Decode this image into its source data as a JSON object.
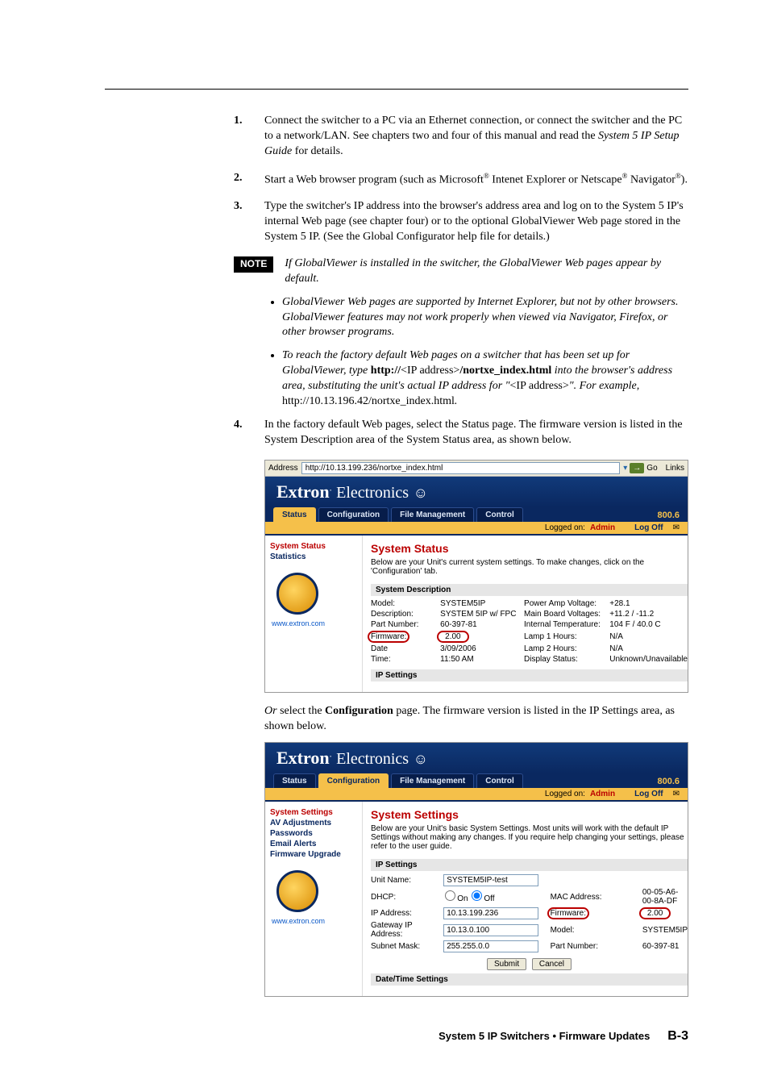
{
  "steps": {
    "s1": "Connect the switcher to a PC via an Ethernet connection, or connect the switcher and the PC to a network/LAN.  See chapters two and four of this manual and read the ",
    "s1_guide": "System 5 IP Setup Guide",
    "s1_tail": " for details.",
    "s2a": "Start a Web browser program (such as Microsoft",
    "s2b": " Intenet Explorer or Netscape",
    "s2c": " Navigator",
    "s2d": ").",
    "s3": "Type the switcher's IP address into the browser's address area and log on to the System 5 IP's internal Web page (see chapter four) or to the optional GlobalViewer Web page stored in the System 5 IP.  (See the Global Configurator help file for details.)",
    "s4": "In the factory default Web pages, select the Status page.  The firmware version is listed in the System Description area of the System Status area, as shown below."
  },
  "note": {
    "label": "NOTE",
    "lead": "If GlobalViewer is installed in the switcher, the GlobalViewer Web pages appear by default.",
    "b1": "GlobalViewer Web pages are supported by Internet Explorer, but not by other browsers.  GlobalViewer features may not work properly when viewed via Navigator, Firefox, or other browser programs.",
    "b2_a": "To reach the factory default Web pages on a switcher that has been set up for GlobalViewer, type ",
    "b2_b": "http://",
    "b2_c": "<IP address>",
    "b2_d": "/nortxe_index.html",
    "b2_e": " into the browser's address area, substituting the unit's actual IP address for \"",
    "b2_f": "<IP address>",
    "b2_g": "\".  For example, ",
    "b2_h": "http://10.13.196.42/nortxe_index.html",
    "b2_i": "."
  },
  "addr": {
    "label": "Address",
    "url": "http://10.13.199.236/nortxe_index.html",
    "go": "Go",
    "links": "Links"
  },
  "brand": {
    "a": "Extron",
    "b": "Electronics",
    "circ": "®"
  },
  "tabs": {
    "status": "Status",
    "config": "Configuration",
    "file": "File Management",
    "control": "Control"
  },
  "phone": "800.6",
  "login": {
    "who": "Logged on:",
    "admin": "Admin",
    "logoff": "Log Off"
  },
  "side1": {
    "a": "System Status",
    "b": "Statistics",
    "url": "www.extron.com"
  },
  "status_panel": {
    "title": "System Status",
    "sub": "Below are your Unit's current system settings. To make changes, click on the 'Configuration' tab.",
    "sec1": "System Description",
    "rows": {
      "model_k": "Model:",
      "model_v": "SYSTEM5IP",
      "desc_k": "Description:",
      "desc_v": "SYSTEM 5IP w/ FPC",
      "part_k": "Part Number:",
      "part_v": "60-397-81",
      "fw_k": "Firmware:",
      "fw_v": "2.00",
      "date_k": "Date",
      "date_v": "3/09/2006",
      "time_k": "Time:",
      "time_v": "11:50 AM",
      "pav_k": "Power Amp Voltage:",
      "pav_v": "+28.1",
      "mbv_k": "Main Board Voltages:",
      "mbv_v": "+11.2 / -11.2",
      "temp_k": "Internal Temperature:",
      "temp_v": "104 F / 40.0 C",
      "l1_k": "Lamp 1 Hours:",
      "l1_v": "N/A",
      "l2_k": "Lamp 2 Hours:",
      "l2_v": "N/A",
      "disp_k": "Display Status:",
      "disp_v": "Unknown/Unavailable"
    },
    "sec2": "IP Settings"
  },
  "para2_a": "Or",
  "para2_b": " select the ",
  "para2_c": "Configuration",
  "para2_d": " page.  The firmware version is listed in the IP Settings area, as shown below.",
  "side2": {
    "a": "System Settings",
    "b": "AV Adjustments",
    "c": "Passwords",
    "d": "Email Alerts",
    "e": "Firmware Upgrade",
    "url": "www.extron.com"
  },
  "settings_panel": {
    "title": "System Settings",
    "sub": "Below are your Unit's basic System Settings. Most units will work with the default IP Settings without making any changes. If you require help changing your settings, please refer to the user guide.",
    "sec1": "IP Settings",
    "rows": {
      "unit_k": "Unit Name:",
      "unit_v": "SYSTEM5IP-test",
      "dhcp_k": "DHCP:",
      "dhcp_on": "On",
      "dhcp_off": "Off",
      "ip_k": "IP Address:",
      "ip_v": "10.13.199.236",
      "gw_k": "Gateway IP Address:",
      "gw_v": "10.13.0.100",
      "sn_k": "Subnet Mask:",
      "sn_v": "255.255.0.0",
      "mac_k": "MAC Address:",
      "mac_v": "00-05-A6-00-8A-DF",
      "fw_k": "Firmware:",
      "fw_v": "2.00",
      "model_k": "Model:",
      "model_v": "SYSTEM5IP",
      "part_k": "Part Number:",
      "part_v": "60-397-81"
    },
    "submit": "Submit",
    "cancel": "Cancel",
    "sec2": "Date/Time Settings"
  },
  "footer": {
    "title": "System 5 IP Switchers • Firmware Updates",
    "page": "B-3"
  }
}
